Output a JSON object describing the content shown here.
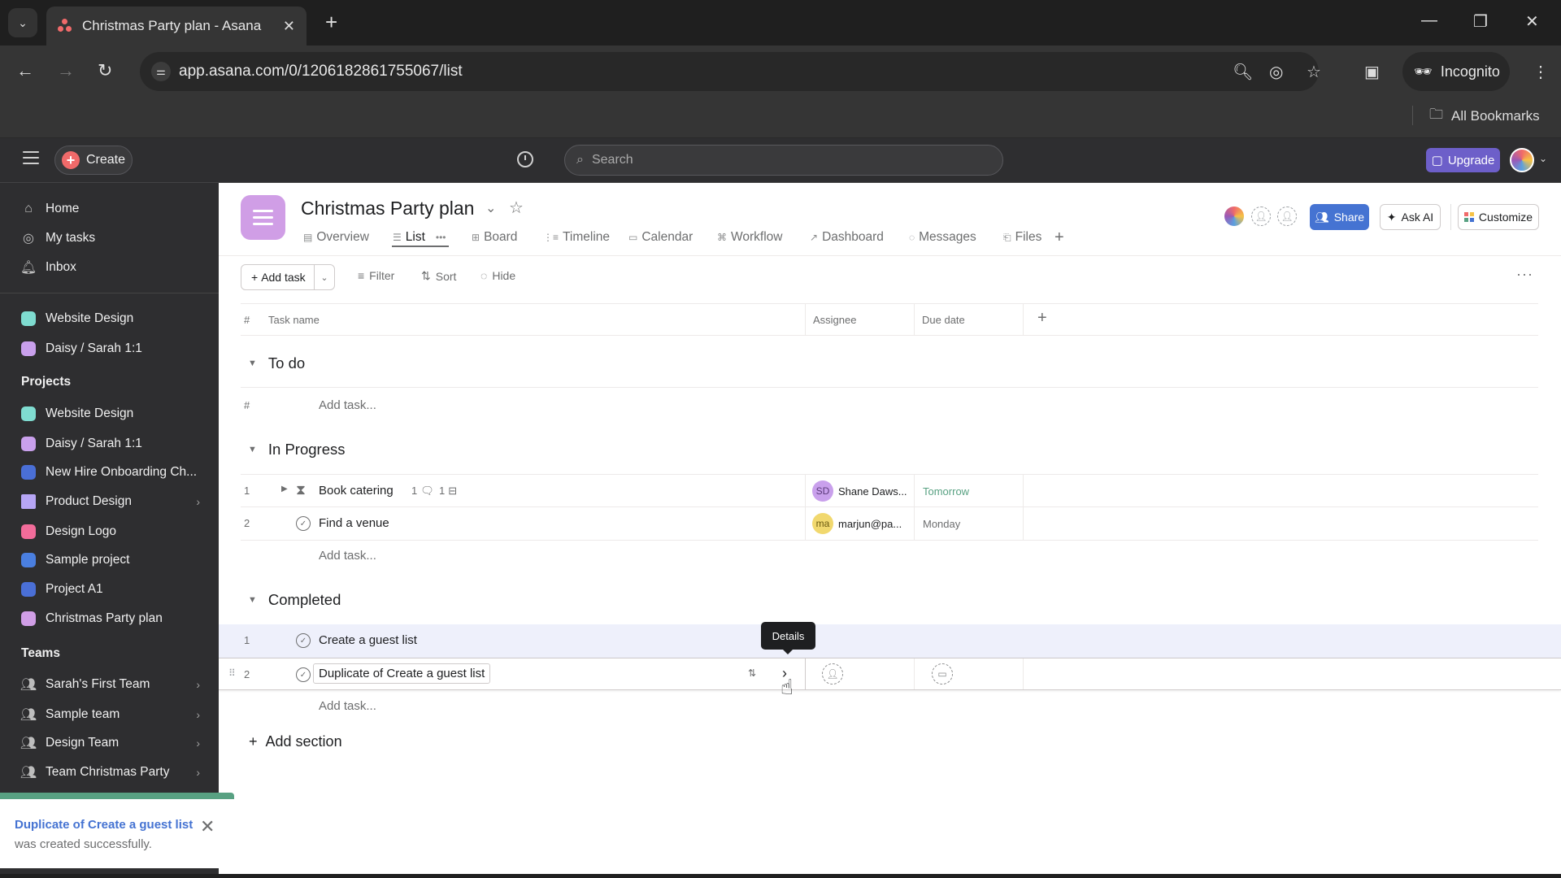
{
  "browser": {
    "tab_title": "Christmas Party plan - Asana",
    "url": "app.asana.com/0/1206182861755067/list",
    "incognito_label": "Incognito",
    "bookmarks_label": "All Bookmarks"
  },
  "topbar": {
    "create_label": "Create",
    "search_placeholder": "Search",
    "upgrade_label": "Upgrade"
  },
  "sidebar": {
    "nav": [
      {
        "label": "Home",
        "icon": "home-icon"
      },
      {
        "label": "My tasks",
        "icon": "check-circle-icon"
      },
      {
        "label": "Inbox",
        "icon": "bell-icon"
      }
    ],
    "favorites": [
      {
        "label": "Website Design",
        "color": "#7fdcd0"
      },
      {
        "label": "Daisy / Sarah 1:1",
        "color": "#c9a0ec"
      }
    ],
    "projects_heading": "Projects",
    "projects": [
      {
        "label": "Website Design",
        "color": "#7fdcd0"
      },
      {
        "label": "Daisy / Sarah 1:1",
        "color": "#c9a0ec"
      },
      {
        "label": "New Hire Onboarding Ch...",
        "color": "#4a6fd6"
      },
      {
        "label": "Product Design",
        "color": "#b7a6f5",
        "folder": true
      },
      {
        "label": "Design Logo",
        "color": "#f26c9a"
      },
      {
        "label": "Sample project",
        "color": "#4a7fe0"
      },
      {
        "label": "Project A1",
        "color": "#4a6fd6"
      },
      {
        "label": "Christmas Party plan",
        "color": "#d09ee6"
      }
    ],
    "teams_heading": "Teams",
    "teams": [
      {
        "label": "Sarah's First Team"
      },
      {
        "label": "Sample team"
      },
      {
        "label": "Design Team"
      },
      {
        "label": "Team Christmas Party"
      }
    ]
  },
  "toast": {
    "link_text": "Duplicate of Create a guest list",
    "message": " was created successfully."
  },
  "project": {
    "title": "Christmas Party plan",
    "tabs": [
      {
        "label": "Overview",
        "icon": "▤"
      },
      {
        "label": "List",
        "icon": "☰",
        "active": true
      },
      {
        "label": "Board",
        "icon": "⊞"
      },
      {
        "label": "Timeline",
        "icon": "⋮≡"
      },
      {
        "label": "Calendar",
        "icon": "▭"
      },
      {
        "label": "Workflow",
        "icon": "⌘"
      },
      {
        "label": "Dashboard",
        "icon": "↗"
      },
      {
        "label": "Messages",
        "icon": "◌"
      },
      {
        "label": "Files",
        "icon": "⎗"
      }
    ],
    "share_label": "Share",
    "ask_ai_label": "Ask AI",
    "customize_label": "Customize"
  },
  "toolbar": {
    "add_task_label": "Add task",
    "filter_label": "Filter",
    "sort_label": "Sort",
    "hide_label": "Hide"
  },
  "table": {
    "columns": {
      "num": "#",
      "task_name": "Task name",
      "assignee": "Assignee",
      "due_date": "Due date"
    },
    "add_task_placeholder": "Add task...",
    "sections": [
      {
        "name": "To do",
        "tasks": []
      },
      {
        "name": "In Progress",
        "tasks": [
          {
            "num": "1",
            "name": "Book catering",
            "comments": "1",
            "subtasks": "1",
            "assignee_initials": "SD",
            "assignee": "Shane Daws...",
            "assignee_color": "#c9a0ec",
            "due": "Tomorrow",
            "due_color": "#58a182",
            "expandable": true
          },
          {
            "num": "2",
            "name": "Find a venue",
            "assignee_initials": "ma",
            "assignee": "marjun@pa...",
            "assignee_color": "#f1d86e",
            "due": "Monday",
            "due_color": "#6d6e6f"
          }
        ]
      },
      {
        "name": "Completed",
        "tasks": [
          {
            "num": "1",
            "name": "Create a guest list"
          },
          {
            "num": "2",
            "name": "Duplicate of Create a guest list"
          }
        ]
      }
    ],
    "add_section_label": "Add section",
    "tooltip": "Details"
  }
}
